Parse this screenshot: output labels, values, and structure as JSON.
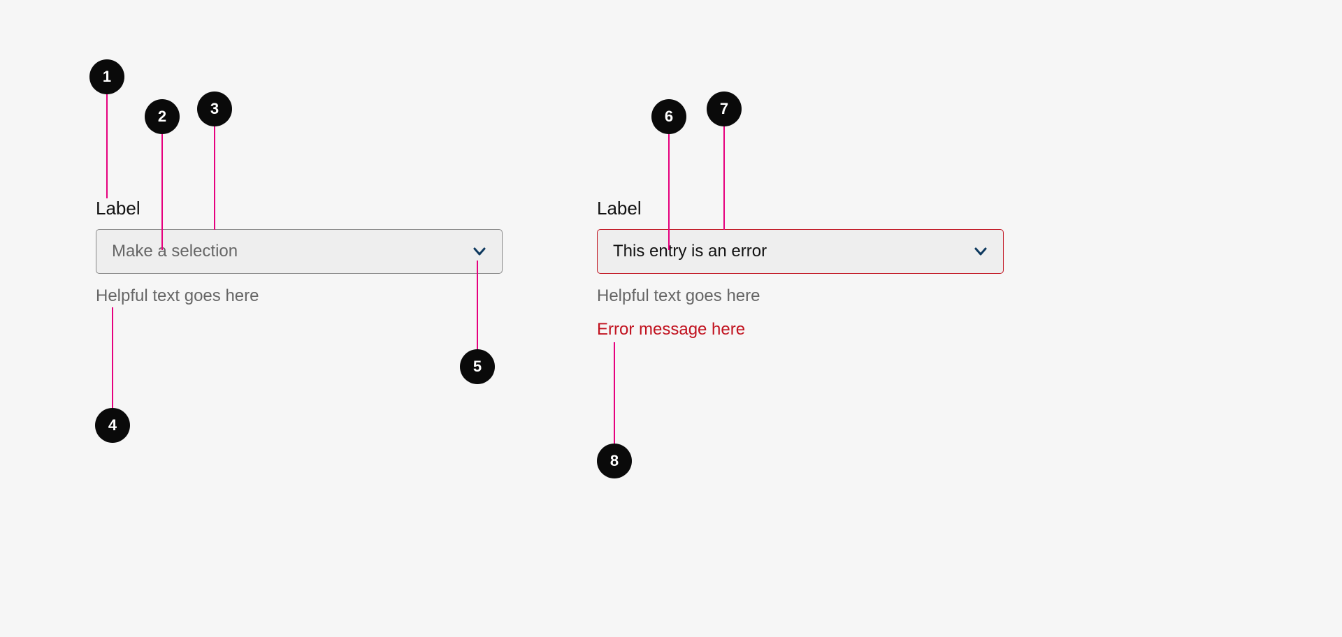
{
  "callouts": {
    "c1": "1",
    "c2": "2",
    "c3": "3",
    "c4": "4",
    "c5": "5",
    "c6": "6",
    "c7": "7",
    "c8": "8"
  },
  "left": {
    "label": "Label",
    "placeholder": "Make a selection",
    "helper": "Helpful text goes here"
  },
  "right": {
    "label": "Label",
    "value": "This entry is an error",
    "helper": "Helpful text goes here",
    "error": "Error message here"
  },
  "colors": {
    "leader": "#e6007e",
    "badge_bg": "#0a0a0a",
    "chevron": "#0f3a5f",
    "error": "#c1121f",
    "muted": "#666666",
    "field_bg": "#eeeeee",
    "border": "#888888"
  }
}
